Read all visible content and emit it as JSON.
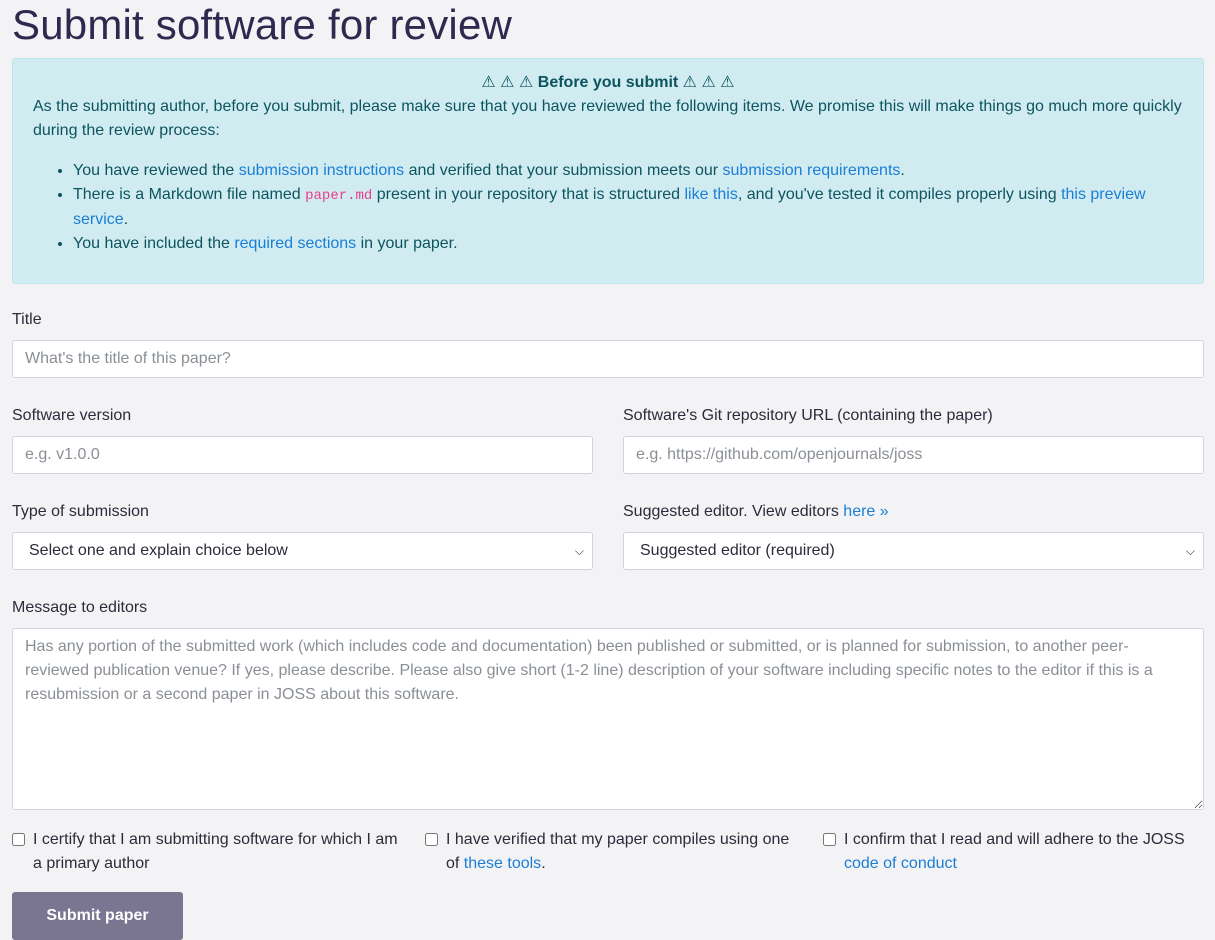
{
  "page_title": "Submit software for review",
  "alert": {
    "heading": "⚠ ⚠ ⚠ Before you submit ⚠ ⚠ ⚠",
    "intro": "As the submitting author, before you submit, please make sure that you have reviewed the following items. We promise this will make things go much more quickly during the review process:",
    "item1": {
      "t1": "You have reviewed the ",
      "link1": "submission instructions",
      "t2": " and verified that your submission meets our ",
      "link2": "submission requirements",
      "t3": "."
    },
    "item2": {
      "t1": "There is a Markdown file named ",
      "code": "paper.md",
      "t2": " present in your repository that is structured ",
      "link1": "like this",
      "t3": ", and you've tested it compiles properly using ",
      "link2": "this preview service",
      "t4": "."
    },
    "item3": {
      "t1": "You have included the ",
      "link1": "required sections",
      "t2": " in your paper."
    }
  },
  "form": {
    "title_label": "Title",
    "title_placeholder": "What's the title of this paper?",
    "version_label": "Software version",
    "version_placeholder": "e.g. v1.0.0",
    "repo_label": "Software's Git repository URL (containing the paper)",
    "repo_placeholder": "e.g. https://github.com/openjournals/joss",
    "type_label": "Type of submission",
    "type_selected": "Select one and explain choice below",
    "editor_label": "Suggested editor. View editors ",
    "editor_link": "here »",
    "editor_selected": "Suggested editor (required)",
    "message_label": "Message to editors",
    "message_placeholder": "Has any portion of the submitted work (which includes code and documentation) been published or submitted, or is planned for submission, to another peer-reviewed publication venue? If yes, please describe. Please also give short (1-2 line) description of your software including specific notes to the editor if this is a resubmission or a second paper in JOSS about this software.",
    "check1": "I certify that I am submitting software for which I am a primary author",
    "check2_text": "I have verified that my paper compiles using one of ",
    "check2_link": "these tools",
    "check2_end": ".",
    "check3_text": "I confirm that I read and will adhere to the JOSS ",
    "check3_link": "code of conduct",
    "submit_label": "Submit paper"
  },
  "colors": {
    "alert_bg": "#d1ecf1",
    "link": "#1a7ed6",
    "button": "#7a7590",
    "heading": "#2e2a4f"
  }
}
